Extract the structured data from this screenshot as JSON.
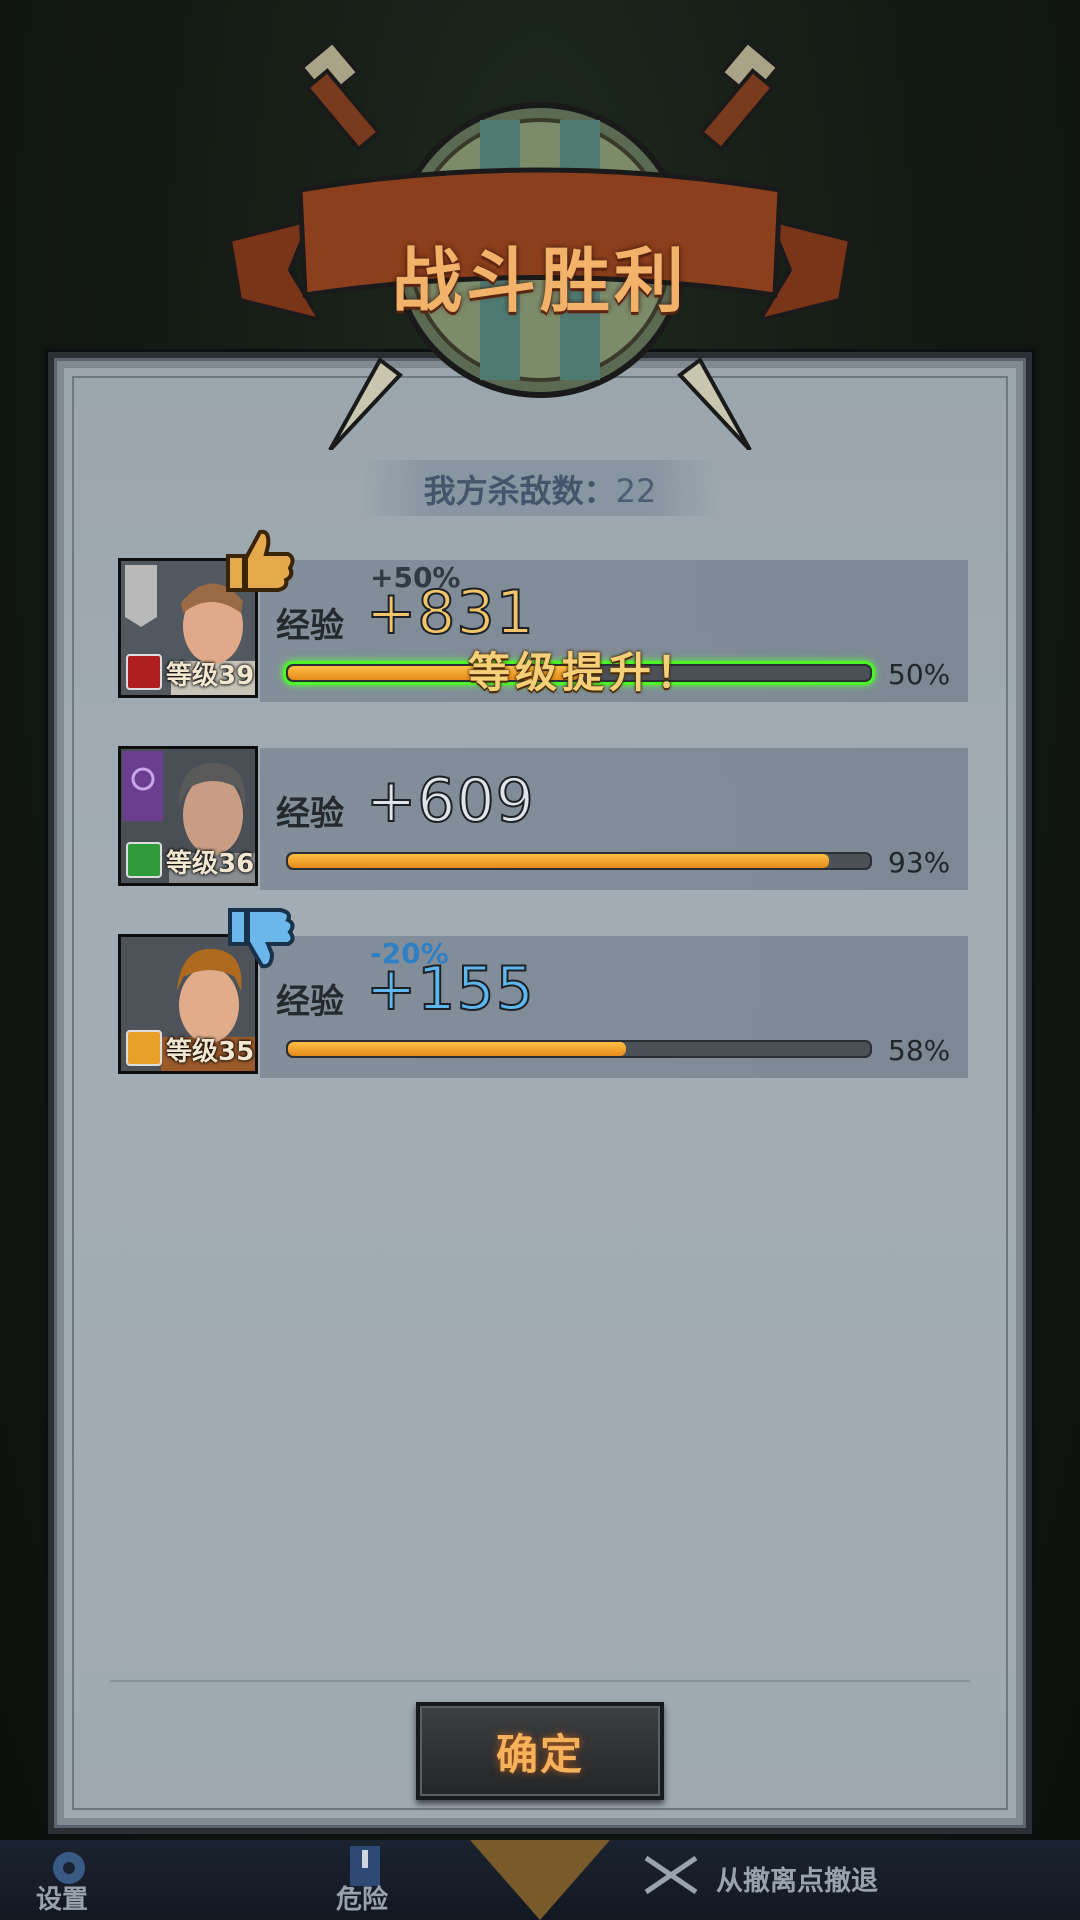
{
  "title": "战斗胜利",
  "kills": {
    "label": "我方杀敌数：",
    "value": "22"
  },
  "heroes": [
    {
      "exp_label": "经验",
      "exp_gain": "+831",
      "bonus": "+50%",
      "level_label": "等级39",
      "progress_pct": 50,
      "progress_text": "50%",
      "level_up_text": "等级提升！",
      "trait": "thumbs-up"
    },
    {
      "exp_label": "经验",
      "exp_gain": "+609",
      "bonus": "",
      "level_label": "等级36",
      "progress_pct": 93,
      "progress_text": "93%",
      "trait": ""
    },
    {
      "exp_label": "经验",
      "exp_gain": "+155",
      "bonus": "-20%",
      "level_label": "等级35",
      "progress_pct": 58,
      "progress_text": "58%",
      "trait": "thumbs-down"
    }
  ],
  "confirm_label": "确定",
  "bottom_bar": {
    "settings": "设置",
    "danger": "危险",
    "retreat": "从撤离点撤退"
  },
  "colors": {
    "title": "#f3b26a",
    "gain_gold": "#f2c56a",
    "gain_white": "#dfe4ea",
    "gain_blue": "#5fb7ef",
    "bar_fill": "#f0a02a",
    "levelup_glow": "#5bff3a"
  }
}
